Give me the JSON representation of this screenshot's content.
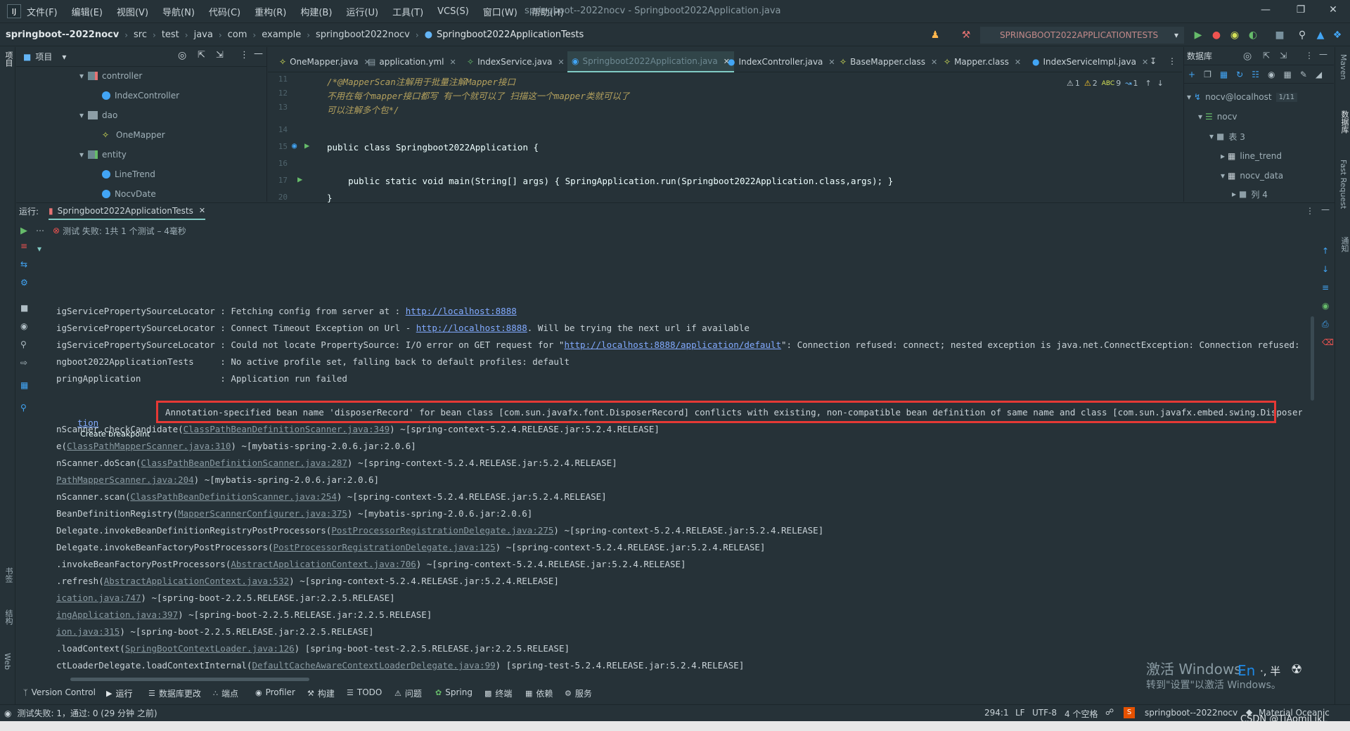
{
  "menu": {
    "items": [
      "文件(F)",
      "编辑(E)",
      "视图(V)",
      "导航(N)",
      "代码(C)",
      "重构(R)",
      "构建(B)",
      "运行(U)",
      "工具(T)",
      "VCS(S)",
      "窗口(W)",
      "帮助(H)"
    ],
    "window_title": "springboot--2022nocv - Springboot2022Application.java",
    "logo": "IJ"
  },
  "navbar": {
    "project": "springboot--2022nocv",
    "crumbs": [
      "src",
      "test",
      "java",
      "com",
      "example",
      "springboot2022nocv",
      "Springboot2022ApplicationTests"
    ],
    "run_config": "SPRINGBOOT2022APPLICATIONTESTS"
  },
  "left_stripe": {
    "project_label": "项目",
    "bookmarks_label": "书签",
    "structure_label": "结构",
    "web_label": "Web"
  },
  "right_stripe": {
    "maven_label": "Maven",
    "database_label": "数据库",
    "fast_request_label": "Fast Request",
    "notifications_label": "通知"
  },
  "project_panel": {
    "title": "项目",
    "tree": [
      {
        "label": "controller",
        "kind": "package"
      },
      {
        "label": "IndexController",
        "kind": "class"
      },
      {
        "label": "dao",
        "kind": "folder"
      },
      {
        "label": "OneMapper",
        "kind": "interface"
      },
      {
        "label": "entity",
        "kind": "package"
      },
      {
        "label": "LineTrend",
        "kind": "class"
      },
      {
        "label": "NocvDate",
        "kind": "class"
      }
    ]
  },
  "editor": {
    "tabs": [
      {
        "label": "OneMapper.java"
      },
      {
        "label": "application.yml"
      },
      {
        "label": "IndexService.java"
      },
      {
        "label": "Springboot2022Application.java",
        "active": true
      },
      {
        "label": "IndexController.java"
      },
      {
        "label": "BaseMapper.class"
      },
      {
        "label": "Mapper.class"
      },
      {
        "label": "IndexServiceImpl.java"
      }
    ],
    "inspections": {
      "warnings": "1",
      "weak_warnings": "2",
      "typos": "9",
      "other": "1"
    },
    "lines": [
      {
        "num": "11",
        "text": "/*@MapperScan注解用于批量注解Mapper接口"
      },
      {
        "num": "12",
        "text": "不用在每个mapper接口都写 有一个就可以了 扫描这一个mapper类就可以了"
      },
      {
        "num": "13",
        "text": "可以注解多个包*/"
      },
      {
        "num": "14",
        "text": ""
      },
      {
        "num": "15",
        "text": "public class Springboot2022Application {"
      },
      {
        "num": "16",
        "text": ""
      },
      {
        "num": "17",
        "text": "    public static void main(String[] args) { SpringApplication.run(Springboot2022Application.class,args); }"
      },
      {
        "num": "20",
        "text": "}"
      }
    ]
  },
  "database_panel": {
    "title": "数据库",
    "connection": "nocv@localhost",
    "conn_badge": "1/11",
    "schema": "nocv",
    "tables_group": "表 3",
    "tables": [
      "line_trend",
      "nocv_data"
    ],
    "columns_group": "列 4"
  },
  "run_panel": {
    "label": "运行:",
    "tab": "Springboot2022ApplicationTests",
    "status": "测试 失败: 1共 1 个测试 – 4毫秒",
    "create_breakpoint": "Create breakpoint"
  },
  "console": {
    "lines": [
      {
        "pre": "igServicePropertySourceLocator : Fetching config from server at : ",
        "url": "http://localhost:8888",
        "post": ""
      },
      {
        "pre": "igServicePropertySourceLocator : Connect Timeout Exception on Url - ",
        "url": "http://localhost:8888",
        "post": ". Will be trying the next url if available"
      },
      {
        "pre": "igServicePropertySourceLocator : Could not locate PropertySource: I/O error on GET request for \"",
        "url": "http://localhost:8888/application/default",
        "post": "\": Connection refused: connect; nested exception is java.net.ConnectException: Connection refused: connect"
      },
      {
        "pre": "ngboot2022ApplicationTests     : No active profile set, falling back to default profiles: default",
        "url": "",
        "post": ""
      },
      {
        "pre": "pringApplication               : Application run failed",
        "url": "",
        "post": ""
      }
    ],
    "exception_link": "tion",
    "exception_message": "Annotation-specified bean name 'disposerRecord' for bean class [com.sun.javafx.font.DisposerRecord] conflicts with existing, non-compatible bean definition of same name and class [com.sun.javafx.embed.swing.DisposerRecord]",
    "stack": [
      {
        "pre": "nScanner.checkCandidate(",
        "link": "ClassPathBeanDefinitionScanner.java:349",
        "post": ") ~[spring-context-5.2.4.RELEASE.jar:5.2.4.RELEASE]"
      },
      {
        "pre": "e(",
        "link": "ClassPathMapperScanner.java:310",
        "post": ") ~[mybatis-spring-2.0.6.jar:2.0.6]"
      },
      {
        "pre": "nScanner.doScan(",
        "link": "ClassPathBeanDefinitionScanner.java:287",
        "post": ") ~[spring-context-5.2.4.RELEASE.jar:5.2.4.RELEASE]"
      },
      {
        "pre": "",
        "link": "PathMapperScanner.java:204",
        "post": ") ~[mybatis-spring-2.0.6.jar:2.0.6]"
      },
      {
        "pre": "nScanner.scan(",
        "link": "ClassPathBeanDefinitionScanner.java:254",
        "post": ") ~[spring-context-5.2.4.RELEASE.jar:5.2.4.RELEASE]"
      },
      {
        "pre": "BeanDefinitionRegistry(",
        "link": "MapperScannerConfigurer.java:375",
        "post": ") ~[mybatis-spring-2.0.6.jar:2.0.6]"
      },
      {
        "pre": "Delegate.invokeBeanDefinitionRegistryPostProcessors(",
        "link": "PostProcessorRegistrationDelegate.java:275",
        "post": ") ~[spring-context-5.2.4.RELEASE.jar:5.2.4.RELEASE]"
      },
      {
        "pre": "Delegate.invokeBeanFactoryPostProcessors(",
        "link": "PostProcessorRegistrationDelegate.java:125",
        "post": ") ~[spring-context-5.2.4.RELEASE.jar:5.2.4.RELEASE]"
      },
      {
        "pre": ".invokeBeanFactoryPostProcessors(",
        "link": "AbstractApplicationContext.java:706",
        "post": ") ~[spring-context-5.2.4.RELEASE.jar:5.2.4.RELEASE]"
      },
      {
        "pre": ".refresh(",
        "link": "AbstractApplicationContext.java:532",
        "post": ") ~[spring-context-5.2.4.RELEASE.jar:5.2.4.RELEASE]"
      },
      {
        "pre": "",
        "link": "ication.java:747",
        "post": ") ~[spring-boot-2.2.5.RELEASE.jar:2.2.5.RELEASE]"
      },
      {
        "pre": "",
        "link": "ingApplication.java:397",
        "post": ") ~[spring-boot-2.2.5.RELEASE.jar:2.2.5.RELEASE]"
      },
      {
        "pre": "",
        "link": "ion.java:315",
        "post": ") ~[spring-boot-2.2.5.RELEASE.jar:2.2.5.RELEASE]"
      },
      {
        "pre": ".loadContext(",
        "link": "SpringBootContextLoader.java:126",
        "post": ") [spring-boot-test-2.2.5.RELEASE.jar:2.2.5.RELEASE]"
      },
      {
        "pre": "ctLoaderDelegate.loadContextInternal(",
        "link": "DefaultCacheAwareContextLoaderDelegate.java:99",
        "post": ") [spring-test-5.2.4.RELEASE.jar:5.2.4.RELEASE]"
      }
    ]
  },
  "bottom_tabs": [
    {
      "label": "Version Control",
      "icon": "branch-icon"
    },
    {
      "label": "运行",
      "icon": "play-icon"
    },
    {
      "label": "数据库更改",
      "icon": "db-icon"
    },
    {
      "label": "端点",
      "icon": "endpoint-icon"
    },
    {
      "label": "Profiler",
      "icon": "profiler-icon"
    },
    {
      "label": "构建",
      "icon": "hammer-icon"
    },
    {
      "label": "TODO",
      "icon": "todo-icon"
    },
    {
      "label": "问题",
      "icon": "problems-icon"
    },
    {
      "label": "Spring",
      "icon": "spring-icon"
    },
    {
      "label": "终端",
      "icon": "terminal-icon"
    },
    {
      "label": "依赖",
      "icon": "deps-icon"
    },
    {
      "label": "服务",
      "icon": "services-icon"
    }
  ],
  "statusbar": {
    "left": "测试失败: 1，通过: 0 (29 分钟 之前)",
    "position": "294:1",
    "line_sep": "LF",
    "encoding": "UTF-8",
    "indent": "4 个空格",
    "project": "springboot--2022nocv",
    "theme": "Material Oceanic"
  },
  "overlay": {
    "activate_title": "激活 Windows",
    "activate_sub": "转到\"设置\"以激活 Windows。",
    "ime": "En",
    "ime_extra": "·, 半",
    "watermark": "CSDN @TiAomiLikL"
  },
  "colors": {
    "background": "#263238",
    "accent": "#80cbc4",
    "error": "#e53935",
    "keyword": "#c792ea",
    "string": "#c3e88d",
    "comment": "#b3a05d"
  }
}
